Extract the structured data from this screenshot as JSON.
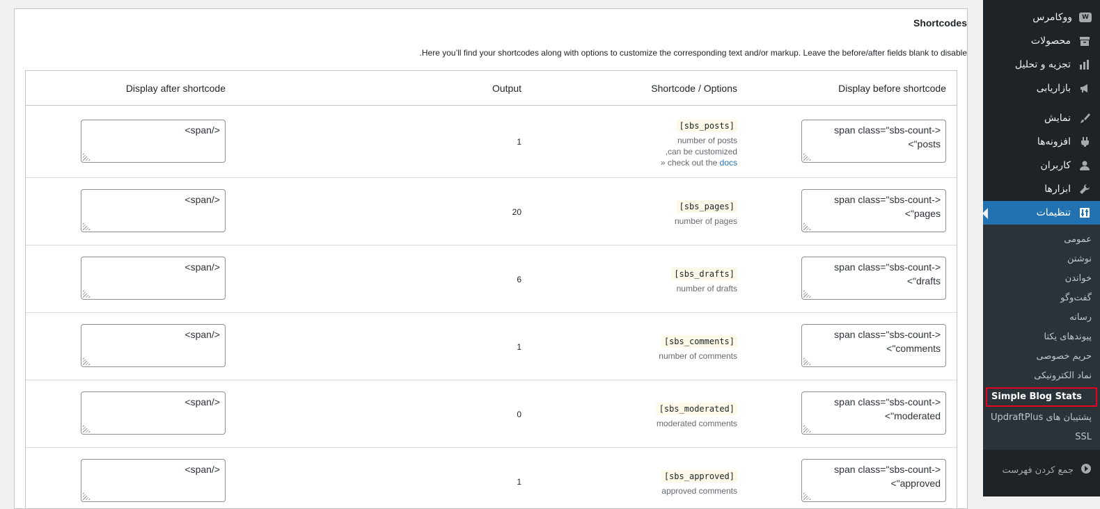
{
  "sidebar": {
    "menu": [
      {
        "label": "ووکامرس",
        "icon": "woo-icon"
      },
      {
        "label": "محصولات",
        "icon": "archive-icon"
      },
      {
        "label": "تجزیه و تحلیل",
        "icon": "chart-bar-icon"
      },
      {
        "label": "بازاریابی",
        "icon": "megaphone-icon"
      },
      {
        "label": "نمایش",
        "icon": "brush-icon"
      },
      {
        "label": "افزونه‌ها",
        "icon": "plugin-icon"
      },
      {
        "label": "کاربران",
        "icon": "user-icon"
      },
      {
        "label": "ابزارها",
        "icon": "wrench-icon"
      },
      {
        "label": "تنظیمات",
        "icon": "settings-icon"
      }
    ],
    "submenu": [
      "عمومی",
      "نوشتن",
      "خواندن",
      "گفت‌وگو",
      "رسانه",
      "پیوندهای یکتا",
      "حریم خصوصی",
      "نماد الکترونیکی",
      "Simple Blog Stats",
      "پشتیبان های UpdraftPlus",
      "SSL"
    ],
    "collapse_label": "جمع کردن فهرست"
  },
  "page": {
    "title": "Shortcodes",
    "intro": ".Here you’ll find your shortcodes along with options to customize the corresponding text and/or markup. Leave the before/after fields blank to disable"
  },
  "table": {
    "headers": {
      "before": "Display before shortcode",
      "shortcode": "Shortcode / Options",
      "output": "Output",
      "after": "Display after shortcode"
    },
    "rows": [
      {
        "before": "<span class=\"sbs-count-posts\">",
        "shortcode": "[sbs_posts]",
        "desc": "number of posts",
        "extra1": "can be customized,",
        "extra2_text": "» check out the ",
        "extra2_link": "docs",
        "output": "1",
        "after": "</span>"
      },
      {
        "before": "<span class=\"sbs-count-pages\">",
        "shortcode": "[sbs_pages]",
        "desc": "number of pages",
        "output": "20",
        "after": "</span>"
      },
      {
        "before": "<span class=\"sbs-count-drafts\">",
        "shortcode": "[sbs_drafts]",
        "desc": "number of drafts",
        "output": "6",
        "after": "</span>"
      },
      {
        "before": "<span class=\"sbs-count-comments\">",
        "shortcode": "[sbs_comments]",
        "desc": "number of comments",
        "output": "1",
        "after": "</span>"
      },
      {
        "before": "<span class=\"sbs-count-moderated\">",
        "shortcode": "[sbs_moderated]",
        "desc": "moderated comments",
        "output": "0",
        "after": "</span>"
      },
      {
        "before": "<span class=\"sbs-count-approved\">",
        "shortcode": "[sbs_approved]",
        "desc": "approved comments",
        "output": "1",
        "after": "</span>"
      }
    ]
  },
  "colors": {
    "sidebar_bg": "#1d2327",
    "submenu_bg": "#2c3338",
    "accent": "#2271b1",
    "highlight_border": "#e60023",
    "code_bg": "#fcf9e8"
  }
}
